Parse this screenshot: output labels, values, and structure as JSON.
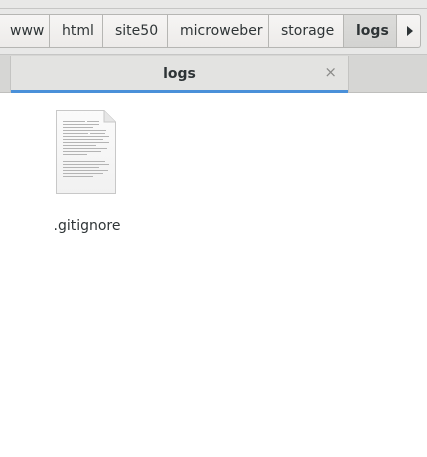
{
  "pathbar": {
    "crumbs": [
      {
        "label": "www"
      },
      {
        "label": "html"
      },
      {
        "label": "site50"
      },
      {
        "label": "microweber"
      },
      {
        "label": "storage"
      },
      {
        "label": "logs"
      }
    ],
    "active_index": 5,
    "scroll_icon": "pan-end-icon"
  },
  "tabs": [
    {
      "label": "logs",
      "close_icon": "close-icon",
      "close_symbol": "×"
    }
  ],
  "files": [
    {
      "name": ".gitignore",
      "icon": "text-document-icon"
    }
  ],
  "colors": {
    "accent": "#4a90d9",
    "toolbar_bg": "#e8e8e7",
    "tabstrip_bg": "#d6d6d4",
    "text": "#2e3436"
  }
}
